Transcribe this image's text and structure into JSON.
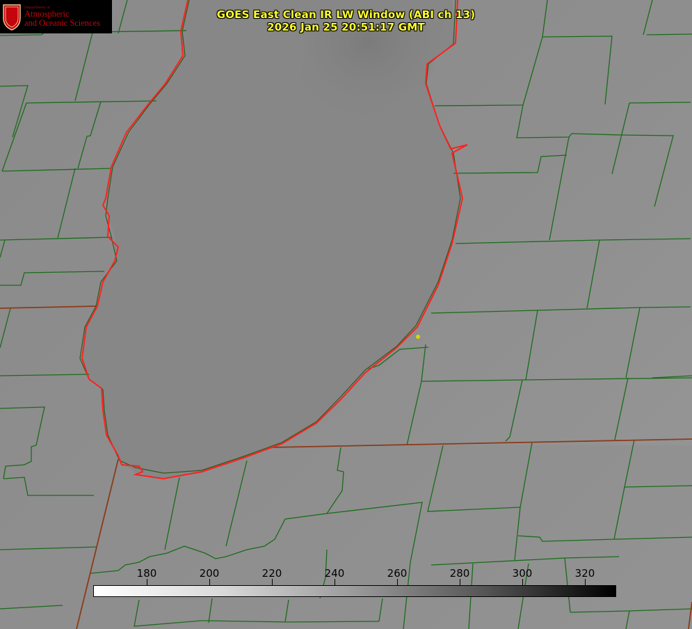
{
  "title": {
    "line1": "GOES East Clean IR LW Window (ABI ch 13)",
    "line2": "2026 Jan 25 20:51:17 GMT"
  },
  "logo": {
    "dept": "Department of",
    "line1": "Atmospheric",
    "line2": "and Oceanic Sciences",
    "seal_letter": "W"
  },
  "colorbar": {
    "ticks": [
      "180",
      "200",
      "220",
      "240",
      "260",
      "280",
      "300",
      "320"
    ],
    "tick_values": [
      180,
      200,
      220,
      240,
      260,
      280,
      300,
      320
    ],
    "range": [
      163,
      330
    ]
  },
  "colors": {
    "coast_red": "#ff2020",
    "county_green": "#1a6b1a",
    "state_brown": "#8b3a1a",
    "title_yellow": "#ffff2a",
    "marker_yellow": "#d8d800"
  }
}
